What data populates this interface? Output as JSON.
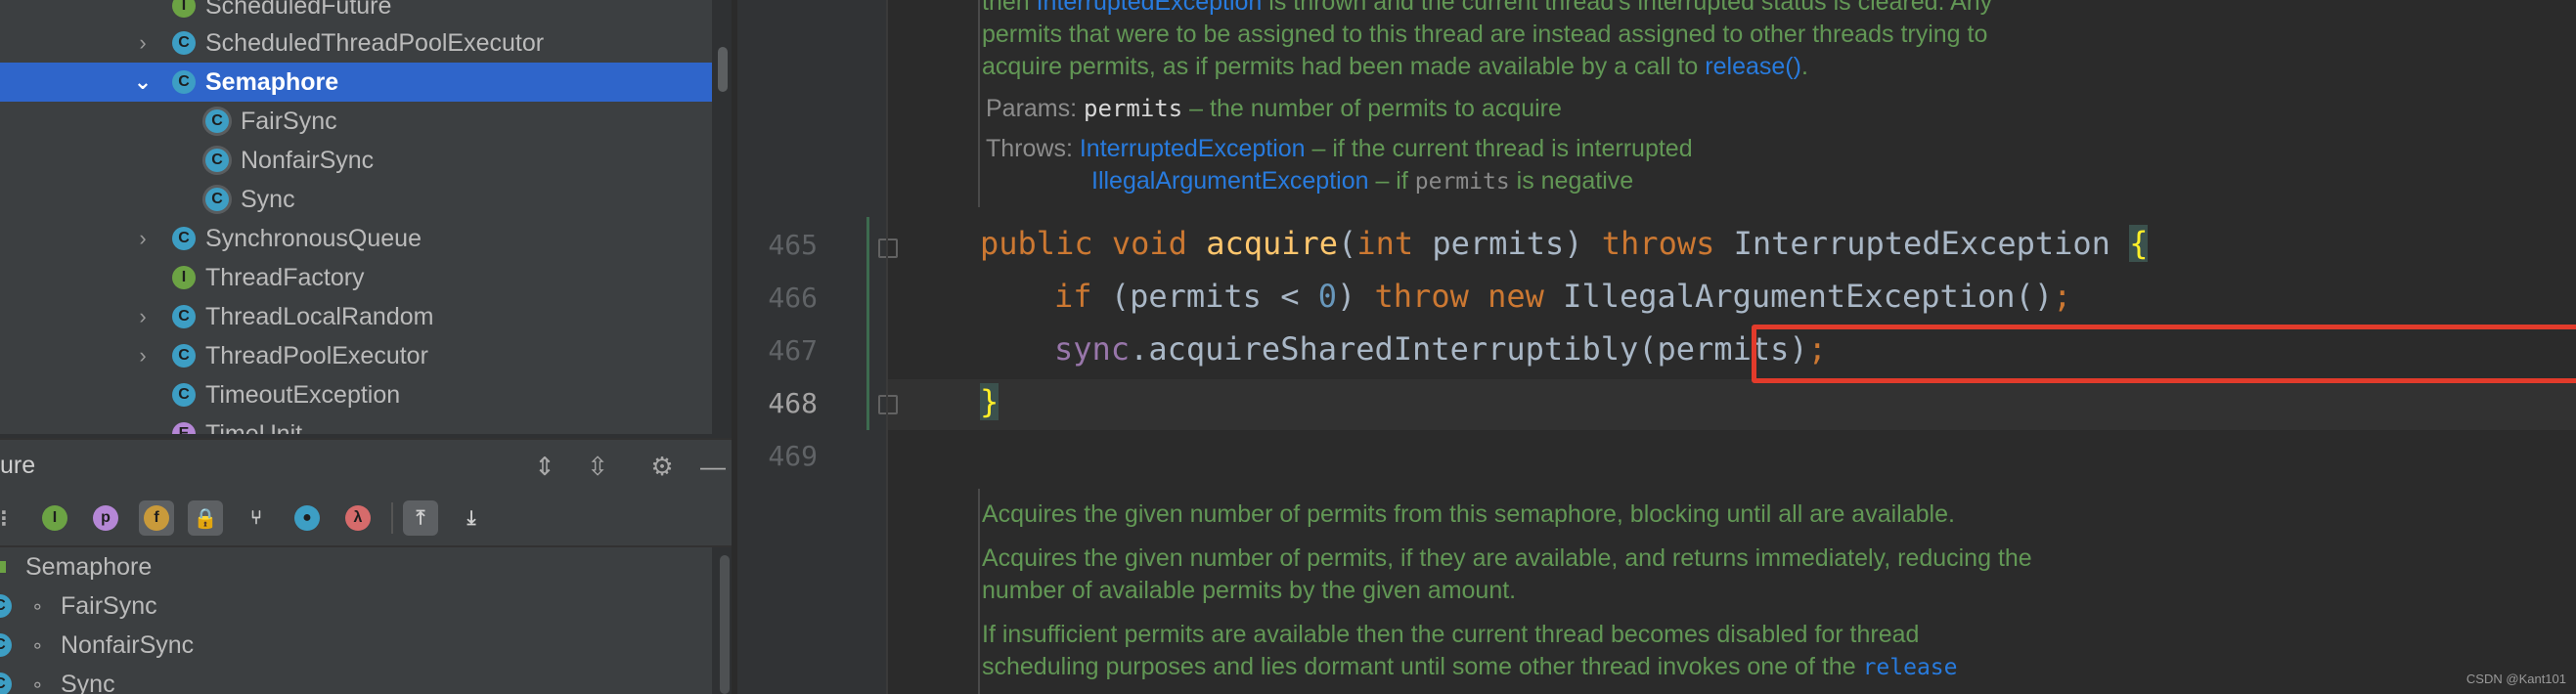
{
  "tree": {
    "items": [
      {
        "label": "ScheduledFuture",
        "icon": "interface-icon",
        "letter": "I",
        "kind": "i",
        "chevron": false
      },
      {
        "label": "ScheduledThreadPoolExecutor",
        "icon": "class-icon",
        "letter": "C",
        "kind": "c",
        "chevron": true
      },
      {
        "label": "Semaphore",
        "icon": "class-icon",
        "letter": "C",
        "kind": "c",
        "chevron": true,
        "selected": true,
        "expanded": true
      },
      {
        "label": "FairSync",
        "icon": "static-class-icon",
        "letter": "C",
        "kind": "sc",
        "chevron": false,
        "indent": 1
      },
      {
        "label": "NonfairSync",
        "icon": "static-class-icon",
        "letter": "C",
        "kind": "sc",
        "chevron": false,
        "indent": 1
      },
      {
        "label": "Sync",
        "icon": "static-class-icon",
        "letter": "C",
        "kind": "sc",
        "chevron": false,
        "indent": 1
      },
      {
        "label": "SynchronousQueue",
        "icon": "class-icon",
        "letter": "C",
        "kind": "c",
        "chevron": true
      },
      {
        "label": "ThreadFactory",
        "icon": "interface-icon",
        "letter": "I",
        "kind": "i",
        "chevron": false
      },
      {
        "label": "ThreadLocalRandom",
        "icon": "class-icon",
        "letter": "C",
        "kind": "c",
        "chevron": true
      },
      {
        "label": "ThreadPoolExecutor",
        "icon": "class-icon",
        "letter": "C",
        "kind": "c",
        "chevron": true
      },
      {
        "label": "TimeoutException",
        "icon": "class-icon",
        "letter": "C",
        "kind": "c",
        "chevron": false
      },
      {
        "label": "TimeUnit",
        "icon": "enum-icon",
        "letter": "E",
        "kind": "e",
        "chevron": false
      }
    ]
  },
  "structure": {
    "title": "ure",
    "root": "Semaphore",
    "items": [
      "FairSync",
      "NonfairSync",
      "Sync"
    ]
  },
  "toolbar": {
    "inherited_letter": "I",
    "property_letter": "p",
    "field_letter": "f",
    "lambda_letter": "λ"
  },
  "doc_top": {
    "line1_pre": "then ",
    "line1_link": "InterruptedException",
    "line1_post": " is thrown and the current thread's interrupted status is cleared. Any",
    "line2": "permits that were to be assigned to this thread are instead assigned to other threads trying to",
    "line3_pre": "acquire permits, as if permits had been made available by a call to ",
    "line3_link": "release()",
    "line3_post": ".",
    "params_tag": "Params:",
    "params_name": "permits",
    "params_desc": " – the number of permits to acquire",
    "throws_tag": "Throws:",
    "throws1_link": "InterruptedException",
    "throws1_desc": " – if the current thread is interrupted",
    "throws2_link": "IllegalArgumentException",
    "throws2_desc_pre": " – if ",
    "throws2_mono": "permits",
    "throws2_desc_post": " is negative"
  },
  "code": {
    "lines": [
      "465",
      "466",
      "467",
      "468",
      "469"
    ],
    "l465": {
      "kw1": "public",
      "kw2": "void",
      "method": "acquire",
      "p1": "(",
      "kw3": "int",
      "param": " permits) ",
      "kw4": "throws",
      "exc": " InterruptedException ",
      "brace": "{"
    },
    "l466": {
      "kw1": "if",
      "p1": " (permits < ",
      "num": "0",
      "p2": ") ",
      "kw2": "throw",
      "kw3": "new",
      "rest": " IllegalArgumentException()",
      "semi": ";"
    },
    "l467": {
      "field": "sync",
      "rest": ".acquireSharedInterruptibly(permits)",
      "semi": ";"
    },
    "l468": {
      "brace": "}"
    }
  },
  "doc_bottom": {
    "p1": "Acquires the given number of permits from this semaphore, blocking until all are available.",
    "p2a": "Acquires the given number of permits, if they are available, and returns immediately, reducing the",
    "p2b": "number of available permits by the given amount.",
    "p3a": "If insufficient permits are available then the current thread becomes disabled for thread",
    "p3b_pre": "scheduling purposes and lies dormant until some other thread invokes one of the ",
    "p3b_link": "release"
  },
  "watermark": "CSDN @Kant101",
  "colors": {
    "selection": "#2f65ca",
    "keyword": "#cc7832",
    "method": "#ffc66d",
    "doc": "#629755",
    "link": "#287bde",
    "highlight": "#e23b2b"
  }
}
